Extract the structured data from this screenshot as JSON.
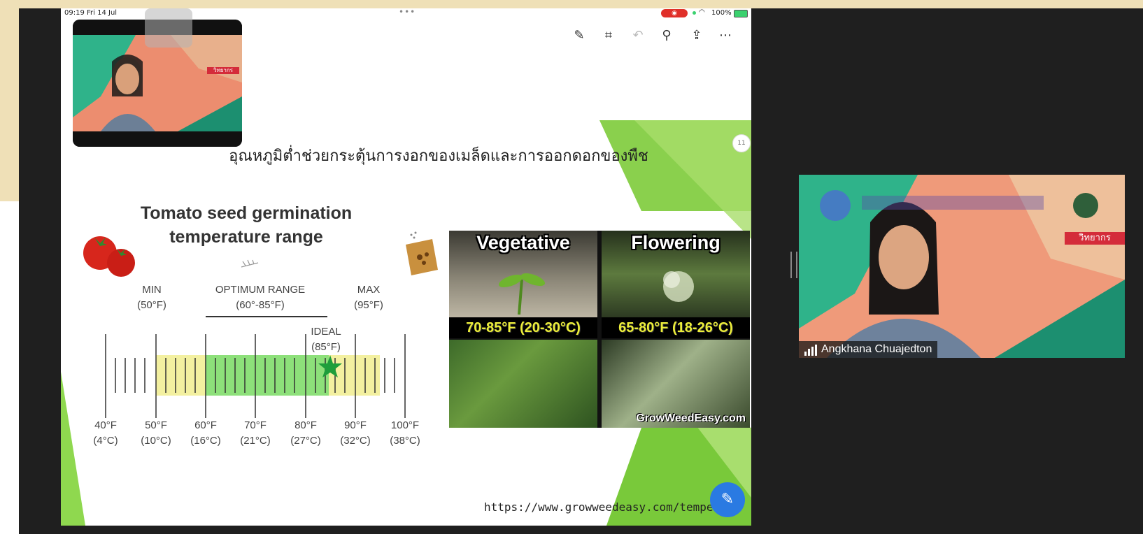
{
  "status_bar": {
    "time": "09:19  Fri 14 Jul",
    "battery": "100%"
  },
  "toolbar": {
    "icons": [
      "markup-icon",
      "crop-icon",
      "undo-icon",
      "search-icon",
      "share-icon",
      "more-icon"
    ]
  },
  "slide": {
    "page_number": "11",
    "thai_title": "อุณหภูมิต่ำช่วยกระตุ้นการงอกของเมล็ดและการออกดอกของพืช",
    "tomato_title_line1": "Tomato seed germination",
    "tomato_title_line2": "temperature range",
    "min_label": "MIN",
    "min_value": "(50°F)",
    "optimum_label": "OPTIMUM RANGE",
    "optimum_value": "(60°-85°F)",
    "max_label": "MAX",
    "max_value": "(95°F)",
    "ideal_label": "IDEAL",
    "ideal_value": "(85°F)",
    "axis_ticks": [
      {
        "f": "40°F",
        "c": "(4°C)"
      },
      {
        "f": "50°F",
        "c": "(10°C)"
      },
      {
        "f": "60°F",
        "c": "(16°C)"
      },
      {
        "f": "70°F",
        "c": "(21°C)"
      },
      {
        "f": "80°F",
        "c": "(27°C)"
      },
      {
        "f": "90°F",
        "c": "(32°C)"
      },
      {
        "f": "100°F",
        "c": "(38°C)"
      }
    ],
    "photo_grid": {
      "vegetative_label": "Vegetative",
      "flowering_label": "Flowering",
      "vegetative_temp": "70-85°F (20-30°C)",
      "flowering_temp": "65-80°F (18-26°C)",
      "watermark": "GrowWeedEasy.com"
    },
    "url": "https://www.growweedeasy.com/temperatu"
  },
  "participant": {
    "name": "Angkhana Chuajedton",
    "banner_tag": "วิทยากร"
  },
  "colors": {
    "accent_green": "#7dcb3a",
    "optimum_green": "#8de07a",
    "range_yellow": "#f3f0a0",
    "pencil_blue": "#2a7ae2"
  }
}
